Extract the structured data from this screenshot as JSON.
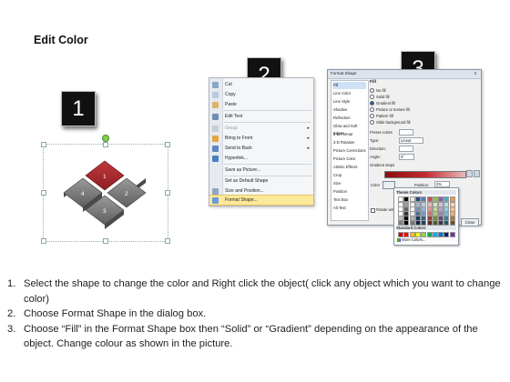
{
  "title": "Edit Color",
  "badges": [
    "1",
    "2",
    "3"
  ],
  "diamond": {
    "tiles": [
      "1",
      "2",
      "3",
      "4"
    ],
    "colors": {
      "highlight": "#a3272c",
      "gray": "#6d6d6d",
      "light": "#8d8d8d"
    }
  },
  "context_menu": {
    "items": [
      {
        "label": "Cut",
        "icon": "scissors-icon",
        "arrow": false
      },
      {
        "label": "Copy",
        "icon": "copy-icon",
        "arrow": false
      },
      {
        "label": "Paste",
        "icon": "paste-icon",
        "arrow": false
      },
      {
        "label": "Edit Text",
        "icon": "edit-text-icon",
        "arrow": false
      },
      {
        "label": "Group",
        "icon": "group-icon",
        "arrow": true
      },
      {
        "label": "Bring to Front",
        "icon": "bring-front-icon",
        "arrow": true
      },
      {
        "label": "Send to Back",
        "icon": "send-back-icon",
        "arrow": true
      },
      {
        "label": "Hyperlink...",
        "icon": "hyperlink-icon",
        "arrow": false
      },
      {
        "label": "Save as Picture...",
        "icon": "",
        "arrow": false
      },
      {
        "label": "Set as Default Shape",
        "icon": "",
        "arrow": false
      },
      {
        "label": "Size and Position...",
        "icon": "size-icon",
        "arrow": false
      },
      {
        "label": "Format Shape...",
        "icon": "format-shape-icon",
        "arrow": false
      }
    ],
    "highlighted": "Format Shape..."
  },
  "dialog": {
    "title": "Format Shape",
    "close": "x",
    "sidebar": [
      "Fill",
      "Line Color",
      "Line Style",
      "Shadow",
      "Reflection",
      "Glow and Soft Edges",
      "3-D Format",
      "3-D Rotation",
      "Picture Corrections",
      "Picture Color",
      "Artistic Effects",
      "Crop",
      "Size",
      "Position",
      "Text Box",
      "Alt Text"
    ],
    "section": "Fill",
    "options": [
      "No fill",
      "Solid fill",
      "Gradient fill",
      "Picture or texture fill",
      "Pattern fill",
      "Slide background fill"
    ],
    "selected_option": "Gradient fill",
    "fields": [
      {
        "label": "Preset colors:",
        "value": ""
      },
      {
        "label": "Type:",
        "value": "Linear"
      },
      {
        "label": "Direction:",
        "value": ""
      },
      {
        "label": "Angle:",
        "value": "0°"
      },
      {
        "label": "Gradient stops",
        "value": ""
      }
    ],
    "color_label": "Color",
    "position_label": "Position:",
    "position_value": "0%",
    "brightness_label": "Brightness:",
    "transparency_label": "Transparency:",
    "rotate_label": "Rotate with shape",
    "close_button": "Close"
  },
  "palette": {
    "theme_header": "Theme Colors",
    "standard_header": "Standard Colors",
    "more": "More Colors...",
    "theme_top": [
      "#ffffff",
      "#000000",
      "#eeece1",
      "#1f497d",
      "#4f81bd",
      "#c0504d",
      "#9bbb59",
      "#8064a2",
      "#4bacc6",
      "#f79646"
    ],
    "standard": [
      "#c00000",
      "#ff0000",
      "#ffc000",
      "#ffff00",
      "#92d050",
      "#00b050",
      "#00b0f0",
      "#0070c0",
      "#002060",
      "#7030a0"
    ]
  },
  "steps": [
    {
      "num": "1.",
      "text": "Select the shape to change the color and Right click the object( click any object which you want to change color)"
    },
    {
      "num": "2.",
      "text": "Choose Format Shape in the dialog box."
    },
    {
      "num": "3.",
      "text": "Choose “Fill” in the Format Shape box then “Solid” or “Gradient” depending on the appearance of the object. Change colour as shown in the picture."
    }
  ]
}
